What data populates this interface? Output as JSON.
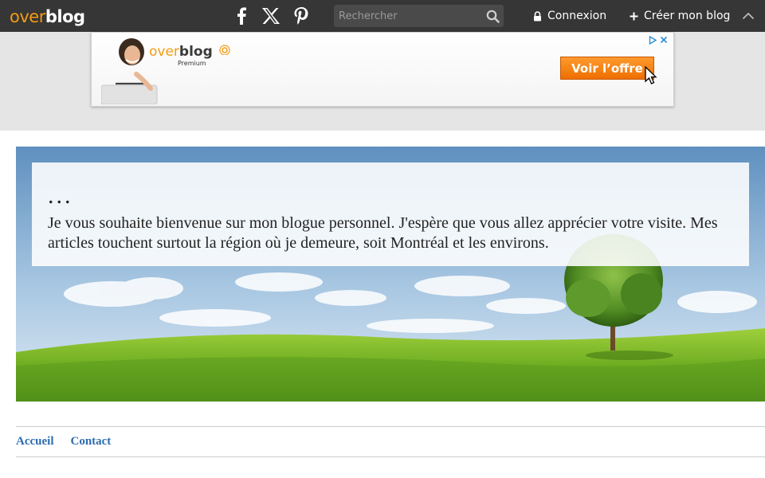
{
  "topbar": {
    "logo_over": "over",
    "logo_blog": "blog",
    "social_icons": [
      "facebook-icon",
      "x-twitter-icon",
      "pinterest-icon"
    ],
    "search": {
      "placeholder": "Rechercher",
      "value": ""
    },
    "connexion_label": "Connexion",
    "create_blog_label": "Créer mon blog",
    "colors": {
      "bar_bg": "#363636",
      "logo_accent": "#f39c12"
    }
  },
  "ad": {
    "logo_over": "over",
    "logo_blog": "blog",
    "subtitle": "Premium",
    "cta_label": "Voir l’offre",
    "colors": {
      "cta": "#ee6f00",
      "adchoices": "#2a8dd8"
    }
  },
  "header": {
    "title": "...",
    "description": "Je vous souhaite bienvenue sur mon blogue personnel. J'espère que vous allez apprécier votre visite. Mes articles touchent surtout la région où je demeure, soit Montréal et les environs."
  },
  "nav": {
    "items": [
      {
        "label": "Accueil"
      },
      {
        "label": "Contact"
      }
    ],
    "link_color": "#2c6cb0"
  }
}
